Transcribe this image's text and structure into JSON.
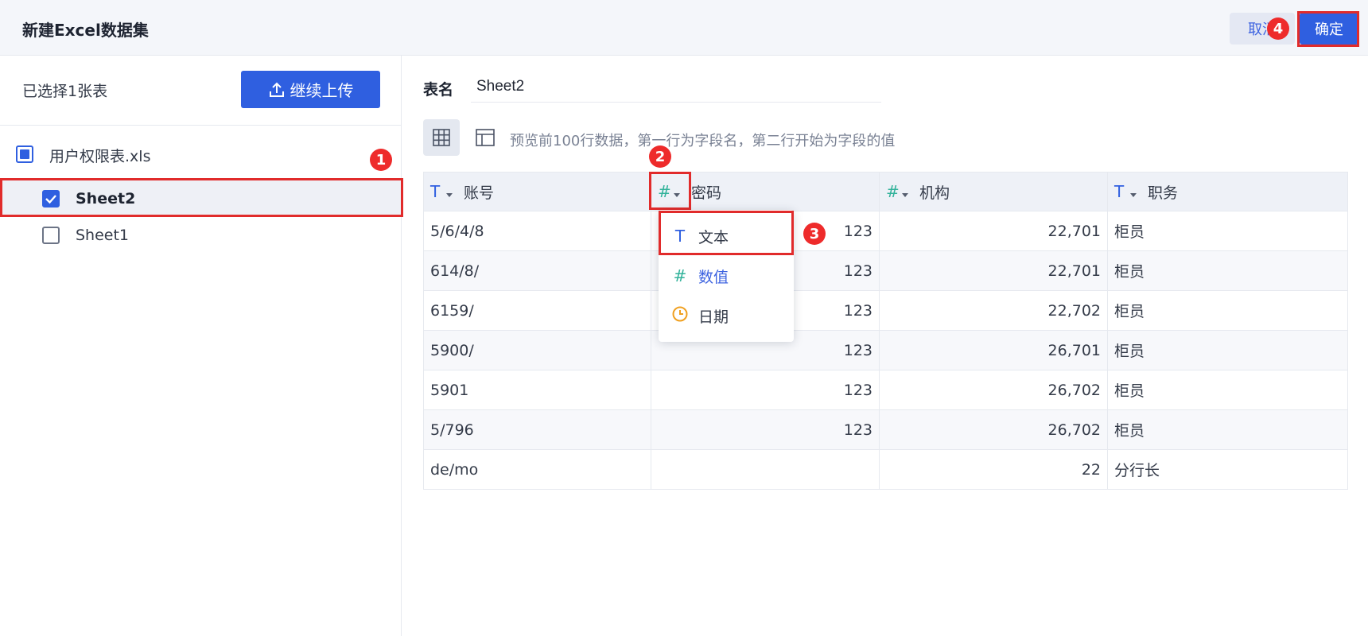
{
  "dialog": {
    "title": "新建Excel数据集",
    "cancel_label": "取消",
    "confirm_label": "确定"
  },
  "left": {
    "selected_count": "已选择1张表",
    "upload_label": "继续上传",
    "file": {
      "name": "用户权限表.xls",
      "state": "partial"
    },
    "sheets": [
      {
        "name": "Sheet2",
        "checked": true
      },
      {
        "name": "Sheet1",
        "checked": false
      }
    ]
  },
  "right": {
    "table_name_label": "表名",
    "table_name_value": "Sheet2",
    "preview_hint": "预览前100行数据，第一行为字段名，第二行开始为字段的值",
    "columns": [
      {
        "type_icon": "T",
        "type": "text",
        "label": "账号"
      },
      {
        "type_icon": "#",
        "type": "number",
        "label": "密码"
      },
      {
        "type_icon": "#",
        "type": "number",
        "label": "机构"
      },
      {
        "type_icon": "T",
        "type": "text",
        "label": "职务"
      }
    ],
    "rows": [
      [
        "5/6/4/8",
        "123",
        "22,701",
        "柜员"
      ],
      [
        "614/8/",
        "123",
        "22,701",
        "柜员"
      ],
      [
        "6159/",
        "123",
        "22,702",
        "柜员"
      ],
      [
        "5900/",
        "123",
        "26,701",
        "柜员"
      ],
      [
        "5901",
        "123",
        "26,702",
        "柜员"
      ],
      [
        "5/796",
        "123",
        "26,702",
        "柜员"
      ],
      [
        "de/mo",
        "",
        "22",
        "分行长"
      ]
    ]
  },
  "type_menu": {
    "items": [
      {
        "icon": "text-type-icon",
        "label": "文本"
      },
      {
        "icon": "number-type-icon",
        "label": "数值",
        "selected": true
      },
      {
        "icon": "clock-icon",
        "label": "日期"
      }
    ]
  },
  "annotations": [
    "1",
    "2",
    "3",
    "4"
  ],
  "colors": {
    "accent": "#2f5fe0",
    "annotation": "#ee2b2b",
    "number_type": "#31b29a",
    "date_type": "#f0a020"
  }
}
